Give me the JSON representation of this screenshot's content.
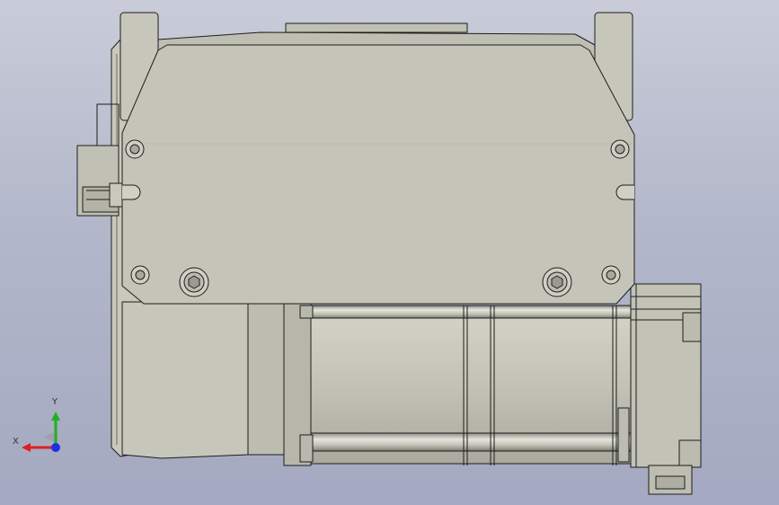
{
  "view": {
    "background_top": "#c9ccd8",
    "background_bottom": "#a4a9c1",
    "part_fill": "#c4c4b8",
    "part_shade": "#b3b3a7",
    "part_light": "#d2d2c6",
    "edge_color": "#1e1e1e"
  },
  "triad": {
    "x_label": "X",
    "y_label": "Y",
    "x_color": "#e02020",
    "y_color": "#20b020",
    "z_color": "#2030e0"
  }
}
